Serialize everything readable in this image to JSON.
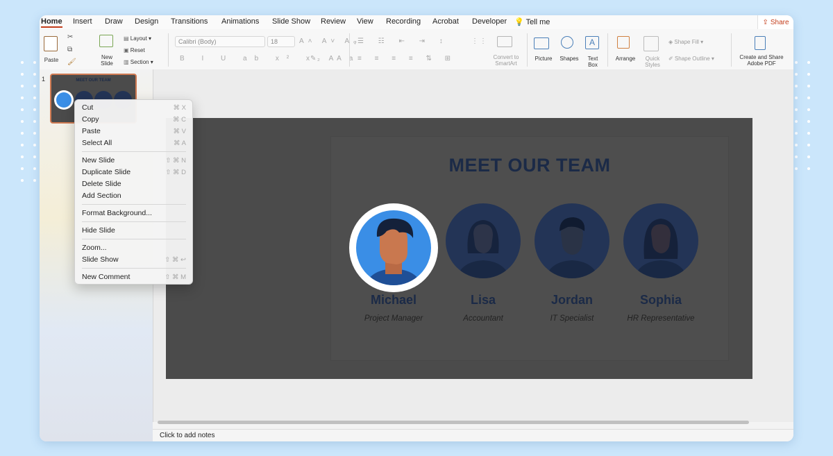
{
  "tabs": [
    "Home",
    "Insert",
    "Draw",
    "Design",
    "Transitions",
    "Animations",
    "Slide Show",
    "Review",
    "View",
    "Recording",
    "Acrobat",
    "Developer"
  ],
  "tell_me": "Tell me",
  "share": "Share",
  "ribbon": {
    "paste": "Paste",
    "new_slide": "New\nSlide",
    "layout": "Layout",
    "reset": "Reset",
    "section": "Section",
    "font_name": "Calibri (Body)",
    "font_size": "18",
    "convert_smartart": "Convert to\nSmartArt",
    "picture": "Picture",
    "shapes": "Shapes",
    "text_box": "Text\nBox",
    "arrange": "Arrange",
    "quick_styles": "Quick\nStyles",
    "shape_fill": "Shape Fill",
    "shape_outline": "Shape Outline",
    "create_share_pdf": "Create and Share\nAdobe PDF"
  },
  "thumbnail": {
    "number": "1",
    "title": "MEET OUR TEAM"
  },
  "context_menu": [
    {
      "label": "Cut",
      "shortcut": "⌘ X"
    },
    {
      "label": "Copy",
      "shortcut": "⌘ C"
    },
    {
      "label": "Paste",
      "shortcut": "⌘ V"
    },
    {
      "label": "Select All",
      "shortcut": "⌘ A"
    },
    {
      "label": "New Slide",
      "shortcut": "⇧ ⌘ N"
    },
    {
      "label": "Duplicate Slide",
      "shortcut": "⇧ ⌘ D"
    },
    {
      "label": "Delete Slide",
      "shortcut": ""
    },
    {
      "label": "Add Section",
      "shortcut": ""
    },
    {
      "label": "Format Background...",
      "shortcut": ""
    },
    {
      "label": "Hide Slide",
      "shortcut": ""
    },
    {
      "label": "Zoom...",
      "shortcut": ""
    },
    {
      "label": "Slide Show",
      "shortcut": "⇧ ⌘ ↩"
    },
    {
      "label": "New Comment",
      "shortcut": "⇧ ⌘ M"
    }
  ],
  "slide": {
    "title": "MEET OUR TEAM",
    "members": [
      {
        "name": "Michael",
        "role": "Project Manager"
      },
      {
        "name": "Lisa",
        "role": "Accountant"
      },
      {
        "name": "Jordan",
        "role": "IT Specialist"
      },
      {
        "name": "Sophia",
        "role": "HR Representative"
      }
    ]
  },
  "notes_placeholder": "Click to add notes",
  "colors": {
    "accent": "#c43e1c",
    "title": "#1b2a47",
    "slide_bg": "#4b4b4b",
    "avatar_bg": "#3a8ee6",
    "background": "#cbe6fb"
  }
}
